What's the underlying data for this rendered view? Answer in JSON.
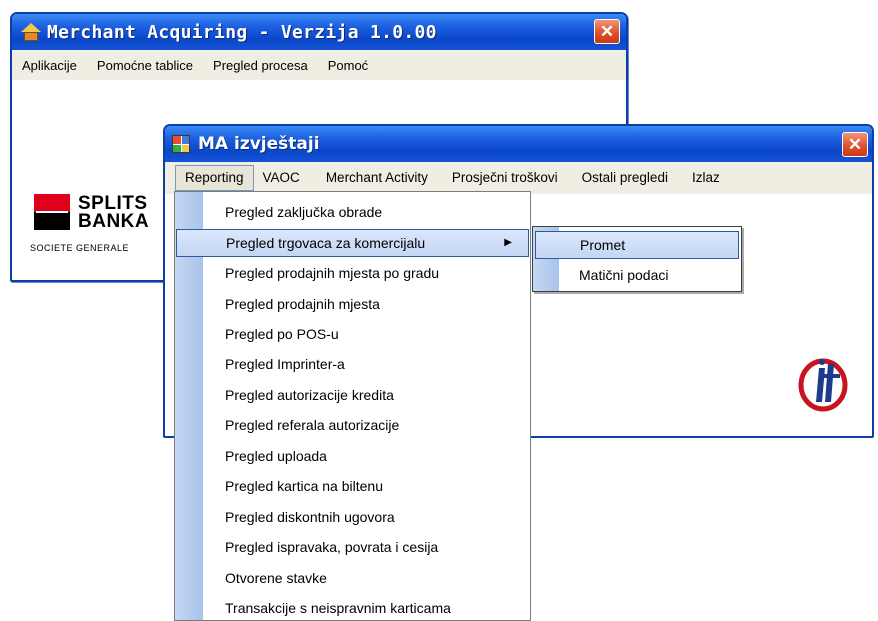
{
  "main_window": {
    "title": "Merchant Acquiring - Verzija 1.0.00",
    "close": "✕",
    "menu": [
      "Aplikacije",
      "Pomoćne tablice",
      "Pregled procesa",
      "Pomoć"
    ],
    "logo": {
      "line1": "SPLITS",
      "line2": "BANKA",
      "line3": "SOCIETE GENERALE"
    }
  },
  "report_window": {
    "title": "MA izvještaji",
    "close": "✕",
    "menu": [
      "Reporting",
      "VAOC",
      "Merchant Activity",
      "Prosječni troškovi",
      "Ostali pregledi",
      "Izlaz"
    ]
  },
  "reporting_menu": {
    "items": [
      "Pregled zaključka obrade",
      "Pregled trgovaca za komercijalu",
      "Pregled prodajnih mjesta po gradu",
      "Pregled prodajnih mjesta",
      "Pregled po POS-u",
      "Pregled Imprinter-a",
      "Pregled autorizacije kredita",
      "Pregled referala autorizacije",
      "Pregled uploada",
      "Pregled kartica na biltenu",
      "Pregled diskontnih ugovora",
      "Pregled ispravaka, povrata i cesija",
      "Otvorene stavke",
      "Transakcije s neispravnim karticama"
    ],
    "selected_index": 1,
    "submenu_arrow": "▶"
  },
  "submenu": {
    "items": [
      "Promet",
      "Matični podaci"
    ],
    "selected_index": 0
  },
  "colors": {
    "titlebar": "#0a47c9",
    "menubar": "#f0ede2",
    "selection": "#c3d6f4",
    "close_button": "#dd4e2a",
    "bank_red": "#e0001b"
  }
}
